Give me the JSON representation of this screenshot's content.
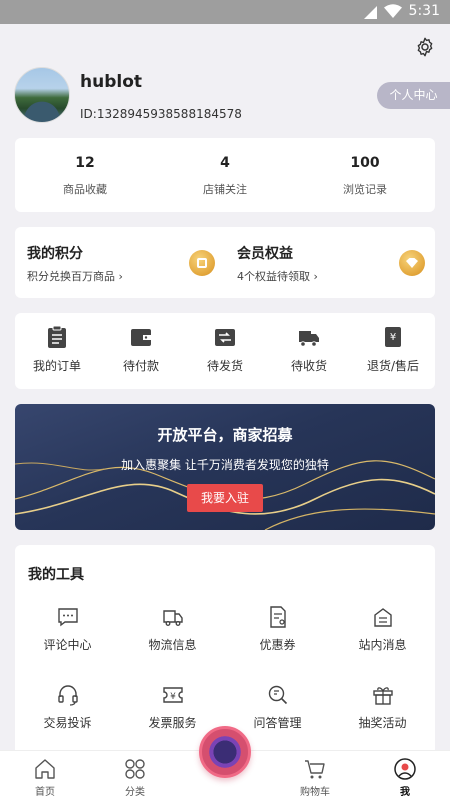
{
  "status_bar": {
    "time": "5:31"
  },
  "profile": {
    "username": "hublot",
    "user_id": "ID:1328945938588184578",
    "center_button": "个人中心"
  },
  "stats": [
    {
      "value": "12",
      "label": "商品收藏"
    },
    {
      "value": "4",
      "label": "店铺关注"
    },
    {
      "value": "100",
      "label": "浏览记录"
    }
  ],
  "points": {
    "title": "我的积分",
    "subtitle": "积分兑换百万商品 ›"
  },
  "membership": {
    "title": "会员权益",
    "subtitle": "4个权益待领取 ›"
  },
  "orders": [
    {
      "label": "我的订单",
      "icon": "clipboard-icon"
    },
    {
      "label": "待付款",
      "icon": "wallet-icon"
    },
    {
      "label": "待发货",
      "icon": "ship-icon"
    },
    {
      "label": "待收货",
      "icon": "truck-icon"
    },
    {
      "label": "退货/售后",
      "icon": "refund-icon"
    }
  ],
  "banner": {
    "title": "开放平台，商家招募",
    "subtitle": "加入惠聚集 让千万消费者发现您的独特",
    "button": "我要入驻"
  },
  "tools": {
    "title": "我的工具",
    "items": [
      {
        "label": "评论中心",
        "icon": "comment-icon"
      },
      {
        "label": "物流信息",
        "icon": "logistics-icon"
      },
      {
        "label": "优惠券",
        "icon": "coupon-icon"
      },
      {
        "label": "站内消息",
        "icon": "message-icon"
      },
      {
        "label": "交易投诉",
        "icon": "headset-icon"
      },
      {
        "label": "发票服务",
        "icon": "invoice-icon"
      },
      {
        "label": "问答管理",
        "icon": "qa-search-icon"
      },
      {
        "label": "抽奖活动",
        "icon": "gift-icon"
      }
    ]
  },
  "tabbar": [
    {
      "label": "首页",
      "icon": "home-icon"
    },
    {
      "label": "分类",
      "icon": "category-icon"
    },
    {
      "label": "",
      "icon": "camera-fab-icon"
    },
    {
      "label": "购物车",
      "icon": "cart-icon"
    },
    {
      "label": "我",
      "icon": "profile-icon"
    }
  ],
  "colors": {
    "accent_red": "#e84a4a",
    "gold": "#e2a53a",
    "banner_bg": "#273558"
  }
}
